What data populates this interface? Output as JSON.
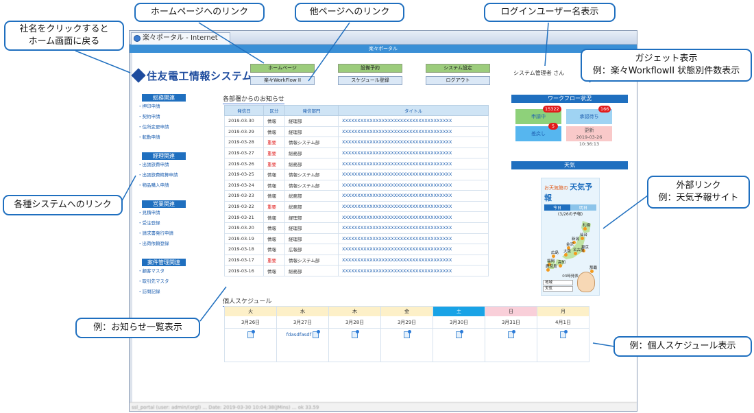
{
  "annotations": {
    "logo_link": "社名をクリックすると\nホーム画面に戻る",
    "home_link": "ホームページへのリンク",
    "other_links": "他ページへのリンク",
    "login_user": "ログインユーザー名表示",
    "gadget": "ガジェット表示\n例：楽々WorkflowII 状態別件数表示",
    "system_links": "各種システムへのリンク",
    "external_link": "外部リンク\n例：天気予報サイト",
    "notice_list": "例：お知らせ一覧表示",
    "schedule": "例：個人スケジュール表示"
  },
  "browser": {
    "tab_title": "楽々ポータル - Internet Explorer",
    "page_header": "楽々ポータル",
    "status_text": "ssl_portal (user: admin/(orgl) ... Date: 2019-03-30 10:04:38(JMins) ... ok 33.59"
  },
  "header": {
    "logo_text": "住友電工情報システム",
    "nav_row1": [
      "ホームページ",
      "設備予約",
      "システム設定"
    ],
    "nav_row2": [
      "楽々WorkFlow II",
      "スケジュール登録",
      "ログアウト"
    ],
    "user_name": "システム管理者 さん"
  },
  "sidebar": {
    "sections": [
      {
        "title": "総務関連",
        "items": [
          "押印申請",
          "契約申請",
          "住所変更申請",
          "転勤申請"
        ]
      },
      {
        "title": "経理関連",
        "items": [
          "出張旅費申請",
          "出張旅費精算申請",
          "物品購入申請"
        ]
      },
      {
        "title": "営業関連",
        "items": [
          "見積申請",
          "受注登録",
          "請求書発行申請",
          "出荷依頼登録"
        ]
      },
      {
        "title": "案件管理関連",
        "items": [
          "顧客マスタ",
          "取引先マスタ",
          "訪問記録"
        ]
      }
    ]
  },
  "notices": {
    "title": "各部署からのお知らせ",
    "columns": [
      "発信日",
      "区分",
      "発信部門",
      "タイトル"
    ],
    "rows": [
      {
        "date": "2019-03-30",
        "type": "情報",
        "dept": "経理部",
        "title": "XXXXXXXXXXXXXXXXXXXXXXXXXXXXXXXXXXXX"
      },
      {
        "date": "2019-03-29",
        "type": "情報",
        "dept": "経理部",
        "title": "XXXXXXXXXXXXXXXXXXXXXXXXXXXXXXXXXXXX"
      },
      {
        "date": "2019-03-28",
        "type": "重要",
        "dept": "情報システム部",
        "title": "XXXXXXXXXXXXXXXXXXXXXXXXXXXXXXXXXXXX"
      },
      {
        "date": "2019-03-27",
        "type": "重要",
        "dept": "総務部",
        "title": "XXXXXXXXXXXXXXXXXXXXXXXXXXXXXXXXXXXX"
      },
      {
        "date": "2019-03-26",
        "type": "重要",
        "dept": "総務部",
        "title": "XXXXXXXXXXXXXXXXXXXXXXXXXXXXXXXXXXXX"
      },
      {
        "date": "2019-03-25",
        "type": "情報",
        "dept": "情報システム部",
        "title": "XXXXXXXXXXXXXXXXXXXXXXXXXXXXXXXXXXXX"
      },
      {
        "date": "2019-03-24",
        "type": "情報",
        "dept": "情報システム部",
        "title": "XXXXXXXXXXXXXXXXXXXXXXXXXXXXXXXXXXXX"
      },
      {
        "date": "2019-03-23",
        "type": "情報",
        "dept": "総務部",
        "title": "XXXXXXXXXXXXXXXXXXXXXXXXXXXXXXXXXXXX"
      },
      {
        "date": "2019-03-22",
        "type": "重要",
        "dept": "総務部",
        "title": "XXXXXXXXXXXXXXXXXXXXXXXXXXXXXXXXXXXX"
      },
      {
        "date": "2019-03-21",
        "type": "情報",
        "dept": "経理部",
        "title": "XXXXXXXXXXXXXXXXXXXXXXXXXXXXXXXXXXXX"
      },
      {
        "date": "2019-03-20",
        "type": "情報",
        "dept": "経理部",
        "title": "XXXXXXXXXXXXXXXXXXXXXXXXXXXXXXXXXXXX"
      },
      {
        "date": "2019-03-19",
        "type": "情報",
        "dept": "経理部",
        "title": "XXXXXXXXXXXXXXXXXXXXXXXXXXXXXXXXXXXX"
      },
      {
        "date": "2019-03-18",
        "type": "情報",
        "dept": "広報部",
        "title": "XXXXXXXXXXXXXXXXXXXXXXXXXXXXXXXXXXXX"
      },
      {
        "date": "2019-03-17",
        "type": "重要",
        "dept": "情報システム部",
        "title": "XXXXXXXXXXXXXXXXXXXXXXXXXXXXXXXXXXXX"
      },
      {
        "date": "2019-03-16",
        "type": "情報",
        "dept": "総務部",
        "title": "XXXXXXXXXXXXXXXXXXXXXXXXXXXXXXXXXXXX"
      }
    ],
    "important_label": "重要",
    "important_color": "#e02020"
  },
  "schedule": {
    "title": "個人スケジュール",
    "days": [
      {
        "dow": "火",
        "date": "3月26日",
        "event": "",
        "kind": "weekday"
      },
      {
        "dow": "水",
        "date": "3月27日",
        "event": "fdasdfasdf",
        "kind": "weekday"
      },
      {
        "dow": "木",
        "date": "3月28日",
        "event": "",
        "kind": "weekday"
      },
      {
        "dow": "金",
        "date": "3月29日",
        "event": "",
        "kind": "weekday"
      },
      {
        "dow": "土",
        "date": "3月30日",
        "event": "",
        "kind": "sat"
      },
      {
        "dow": "日",
        "date": "3月31日",
        "event": "",
        "kind": "sun"
      },
      {
        "dow": "月",
        "date": "4月1日",
        "event": "",
        "kind": "weekday"
      }
    ]
  },
  "workflow": {
    "title": "ワークフロー状況",
    "in_progress": {
      "label": "申請中",
      "count": "15322",
      "color": "#8ed17a"
    },
    "pending": {
      "label": "承認待ち",
      "count": "166",
      "color": "#9fd3f3"
    },
    "returned": {
      "label": "差戻し",
      "count": "5",
      "color": "#56b6ef"
    },
    "updated": {
      "label": "更新",
      "time": "2019-03-26 10:36:13",
      "color": "#f9c9c9"
    }
  },
  "weather": {
    "title": "天気",
    "brand": "お天気館の",
    "heading": "天気予報",
    "tabs": [
      "今日",
      "明日"
    ],
    "subtitle": "(3/26の予報)",
    "cities": [
      "札幌",
      "仙台",
      "新潟",
      "金沢",
      "東京",
      "名古屋",
      "大阪",
      "広島",
      "福岡",
      "高知",
      "鹿児島",
      "那覇"
    ],
    "footnote": "03時発表",
    "select1": "地域",
    "select2": "天気"
  }
}
